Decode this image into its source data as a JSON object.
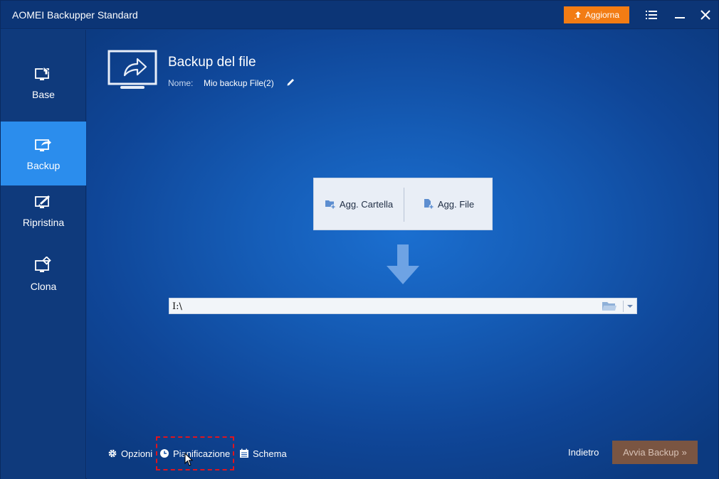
{
  "window": {
    "title": "AOMEI Backupper Standard",
    "upgrade_label": "Aggiorna"
  },
  "colors": {
    "accent": "#2b8ded",
    "upgrade": "#f27c14",
    "highlight": "#e0141e",
    "start_button": "#7a5542"
  },
  "sidebar": {
    "items": [
      {
        "label": "Base",
        "icon": "home-monitor-icon",
        "active": false
      },
      {
        "label": "Backup",
        "icon": "backup-monitor-icon",
        "active": true
      },
      {
        "label": "Ripristina",
        "icon": "restore-monitor-icon",
        "active": false
      },
      {
        "label": "Clona",
        "icon": "clone-monitor-icon",
        "active": false
      }
    ]
  },
  "header": {
    "title": "Backup del file",
    "name_label": "Nome:",
    "name_value": "Mio backup File(2)"
  },
  "source": {
    "add_folder_label": "Agg. Cartella",
    "add_file_label": "Agg. File"
  },
  "destination": {
    "value": "I:\\"
  },
  "footer": {
    "options_label": "Opzioni",
    "schedule_label": "Pianificazione",
    "scheme_label": "Schema",
    "back_label": "Indietro",
    "start_label": "Avvia Backup",
    "start_suffix": "»"
  }
}
